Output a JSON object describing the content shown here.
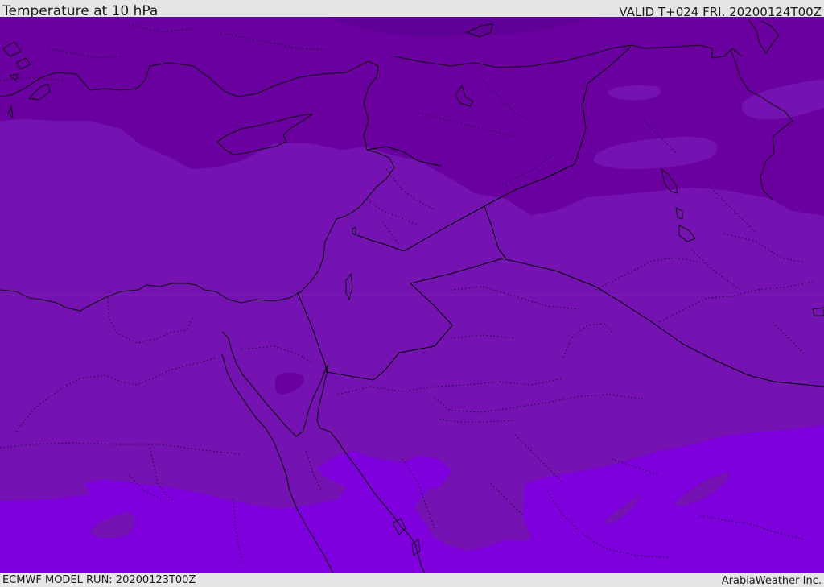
{
  "header": {
    "title": "Temperature at 10 hPa",
    "valid": "VALID T+024 FRI. 20200124T00Z"
  },
  "footer": {
    "model_run": "ECMWF MODEL RUN: 20200123T00Z",
    "credit": "ArabiaWeather Inc."
  },
  "colors": {
    "bar_background": "#e6e6e6",
    "band_coldest": "#5f0096",
    "band_cold": "#6a00a0",
    "band_mid": "#7512b2",
    "band_warm": "#7e00dc",
    "coastline": "#111111",
    "border": "#000000"
  }
}
